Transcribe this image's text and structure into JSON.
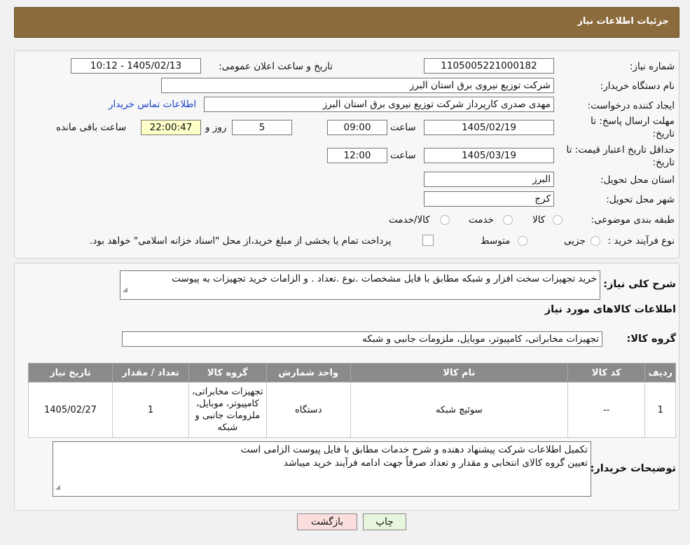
{
  "header": {
    "title": "جزئیات اطلاعات نیاز"
  },
  "form": {
    "need_number_label": "شماره نیاز:",
    "need_number": "1105005221000182",
    "announce_label": "تاریخ و ساعت اعلان عمومی:",
    "announce_value": "1405/02/13 - 10:12",
    "buyer_org_label": "نام دستگاه خریدار:",
    "buyer_org": "شرکت توزیع نیروی برق استان البرز",
    "creator_label": "ایجاد کننده درخواست:",
    "creator": "مهدی صدری کارپرداز شرکت توزیع نیروی برق استان البرز",
    "contact_link": "اطلاعات تماس خریدار",
    "deadline_label_1": "مهلت ارسال پاسخ: تا",
    "deadline_label_2": "تاریخ:",
    "deadline_date": "1405/02/19",
    "time_label": "ساعت",
    "deadline_time": "09:00",
    "days_value": "5",
    "days_label": "روز و",
    "remaining_time": "22:00:47",
    "remaining_label": "ساعت باقی مانده",
    "validity_label_1": "حداقل تاریخ اعتبار قیمت: تا",
    "validity_label_2": "تاریخ:",
    "validity_date": "1405/03/19",
    "validity_time": "12:00",
    "province_label": "استان محل تحویل:",
    "province": "البرز",
    "city_label": "شهر محل تحویل:",
    "city": "کرج",
    "category_label": "طبقه بندی موضوعی:",
    "category_options": [
      "کالا",
      "خدمت",
      "کالا/خدمت"
    ],
    "process_label": "نوع فرآیند خرید :",
    "process_options": [
      "جزیی",
      "متوسط"
    ],
    "process_note": "پرداخت تمام یا بخشی از مبلغ خرید،از محل \"اسناد خزانه اسلامی\" خواهد بود."
  },
  "summary": {
    "desc_label": "شرح کلی نیاز:",
    "desc": "خرید تجهیزات سخت افزار و شبکه مطابق با فایل مشخصات .نوع .تعداد . و الزامات خرید تجهیزات به پیوست",
    "goods_info_title": "اطلاعات کالاهای مورد نیاز",
    "goods_group_label": "گروه کالا:",
    "goods_group": "تجهیزات مخابراتی، کامپیوتر، موبایل، ملزومات جانبی و شبکه"
  },
  "table": {
    "headers": [
      "ردیف",
      "کد کالا",
      "نام کالا",
      "واحد شمارش",
      "گروه کالا",
      "تعداد / مقدار",
      "تاریخ نیاز"
    ],
    "rows": [
      [
        "1",
        "--",
        "سوئیچ شبکه",
        "دستگاه",
        "تجهیزات مخابراتی، کامپیوتر، موبایل، ملزومات جانبی و شبکه",
        "1",
        "1405/02/27"
      ]
    ]
  },
  "buyer_notes": {
    "label": "توضیحات خریدار:",
    "line1": "تکمیل اطلاعات شرکت پیشنهاد دهنده و شرح خدمات مطابق با فایل پیوست الزامی است",
    "line2": "تعیین گروه کالای انتخابی و مقدار و تعداد صرفاً جهت ادامه فرآیند خرید میباشد"
  },
  "buttons": {
    "print": "چاپ",
    "back": "بازگشت"
  },
  "colors": {
    "header_bg": "#8b6a3c",
    "table_header_bg": "#8a8a8a",
    "print_btn": "#e6f5dc",
    "back_btn": "#fbdede",
    "remaining_bg": "#ffffc8"
  }
}
